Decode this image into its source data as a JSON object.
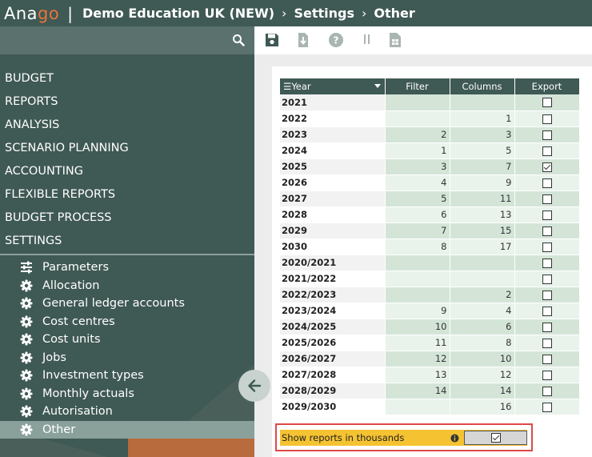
{
  "header": {
    "logo_part1": "Ana",
    "logo_part2": "go",
    "separator": "|",
    "crumbs": [
      "Demo Education UK (NEW)",
      "Settings",
      "Other"
    ],
    "crumb_sep": "›"
  },
  "sidebar": {
    "menu": [
      "BUDGET",
      "REPORTS",
      "ANALYSIS",
      "SCENARIO PLANNING",
      "ACCOUNTING",
      "FLEXIBLE REPORTS",
      "BUDGET PROCESS",
      "SETTINGS"
    ],
    "sub_items": [
      {
        "label": "Parameters",
        "icon": "sliders-icon"
      },
      {
        "label": "Allocation",
        "icon": "gear-icon"
      },
      {
        "label": "General ledger accounts",
        "icon": "gear-icon"
      },
      {
        "label": "Cost centres",
        "icon": "gear-icon"
      },
      {
        "label": "Cost units",
        "icon": "gear-icon"
      },
      {
        "label": "Jobs",
        "icon": "gear-icon"
      },
      {
        "label": "Investment types",
        "icon": "gear-icon"
      },
      {
        "label": "Monthly actuals",
        "icon": "gear-icon"
      },
      {
        "label": "Autorisation",
        "icon": "gear-icon"
      },
      {
        "label": "Other",
        "icon": "gear-icon",
        "active": true
      }
    ]
  },
  "table": {
    "headers": {
      "year": "Year",
      "filter": "Filter",
      "columns": "Columns",
      "export": "Export"
    },
    "rows": [
      {
        "year": "2021",
        "filter": "",
        "columns": "",
        "export": false
      },
      {
        "year": "2022",
        "filter": "",
        "columns": "1",
        "export": false
      },
      {
        "year": "2023",
        "filter": "2",
        "columns": "3",
        "export": false
      },
      {
        "year": "2024",
        "filter": "1",
        "columns": "5",
        "export": false
      },
      {
        "year": "2025",
        "filter": "3",
        "columns": "7",
        "export": true
      },
      {
        "year": "2026",
        "filter": "4",
        "columns": "9",
        "export": false
      },
      {
        "year": "2027",
        "filter": "5",
        "columns": "11",
        "export": false
      },
      {
        "year": "2028",
        "filter": "6",
        "columns": "13",
        "export": false
      },
      {
        "year": "2029",
        "filter": "7",
        "columns": "15",
        "export": false
      },
      {
        "year": "2030",
        "filter": "8",
        "columns": "17",
        "export": false
      },
      {
        "year": "2020/2021",
        "filter": "",
        "columns": "",
        "export": false
      },
      {
        "year": "2021/2022",
        "filter": "",
        "columns": "",
        "export": false
      },
      {
        "year": "2022/2023",
        "filter": "",
        "columns": "2",
        "export": false
      },
      {
        "year": "2023/2024",
        "filter": "9",
        "columns": "4",
        "export": false
      },
      {
        "year": "2024/2025",
        "filter": "10",
        "columns": "6",
        "export": false
      },
      {
        "year": "2025/2026",
        "filter": "11",
        "columns": "8",
        "export": false
      },
      {
        "year": "2026/2027",
        "filter": "12",
        "columns": "10",
        "export": false
      },
      {
        "year": "2027/2028",
        "filter": "13",
        "columns": "12",
        "export": false
      },
      {
        "year": "2028/2029",
        "filter": "14",
        "columns": "14",
        "export": false
      },
      {
        "year": "2029/2030",
        "filter": "",
        "columns": "16",
        "export": false
      }
    ]
  },
  "option": {
    "label": "Show reports in thousands",
    "checked": true
  },
  "colors": {
    "header_bg": "#3f5954",
    "accent_orange": "#e8743b",
    "highlight_yellow": "#f5c332",
    "highlight_border": "#e04848"
  }
}
